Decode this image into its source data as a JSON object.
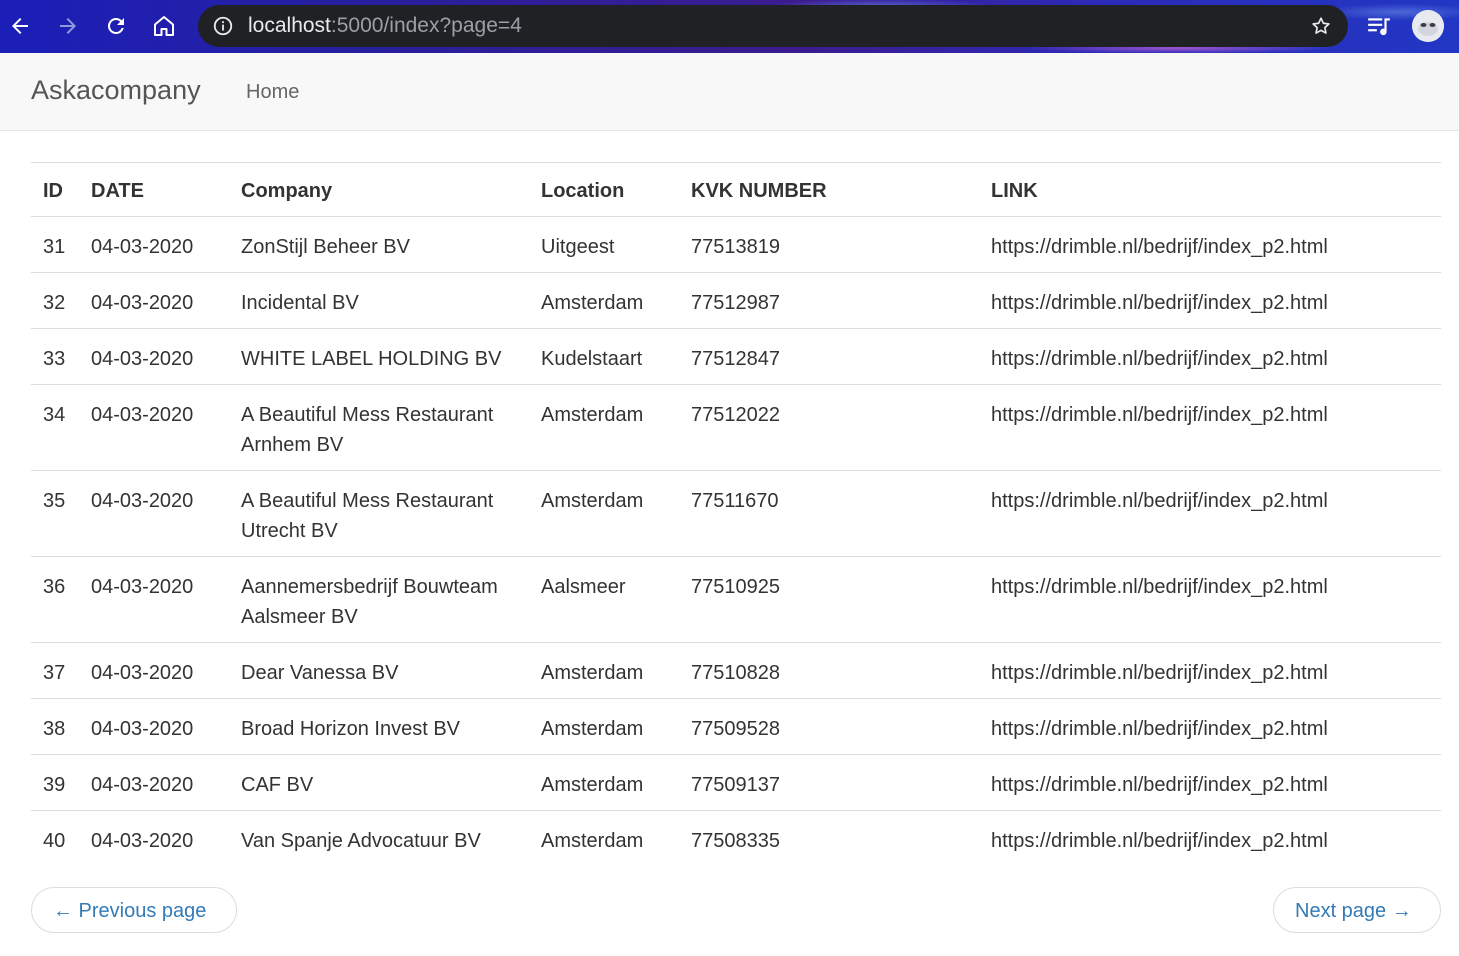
{
  "browser": {
    "url_host": "localhost",
    "url_rest": ":5000/index?page=4"
  },
  "navbar": {
    "brand": "Askacompany",
    "home": "Home"
  },
  "table": {
    "headers": {
      "id": "ID",
      "date": "DATE",
      "company": "Company",
      "location": "Location",
      "kvk": "KVK NUMBER",
      "link": "LINK"
    },
    "rows": [
      {
        "id": "31",
        "date": "04-03-2020",
        "company": "ZonStijl Beheer BV",
        "location": "Uitgeest",
        "kvk": "77513819",
        "link": "https://drimble.nl/bedrijf/index_p2.html"
      },
      {
        "id": "32",
        "date": "04-03-2020",
        "company": "Incidental BV",
        "location": "Amsterdam",
        "kvk": "77512987",
        "link": "https://drimble.nl/bedrijf/index_p2.html"
      },
      {
        "id": "33",
        "date": "04-03-2020",
        "company": "WHITE LABEL HOLDING BV",
        "location": "Kudelstaart",
        "kvk": "77512847",
        "link": "https://drimble.nl/bedrijf/index_p2.html"
      },
      {
        "id": "34",
        "date": "04-03-2020",
        "company": "A Beautiful Mess Restaurant Arnhem BV",
        "location": "Amsterdam",
        "kvk": "77512022",
        "link": "https://drimble.nl/bedrijf/index_p2.html"
      },
      {
        "id": "35",
        "date": "04-03-2020",
        "company": "A Beautiful Mess Restaurant Utrecht BV",
        "location": "Amsterdam",
        "kvk": "77511670",
        "link": "https://drimble.nl/bedrijf/index_p2.html"
      },
      {
        "id": "36",
        "date": "04-03-2020",
        "company": "Aannemersbedrijf Bouwteam Aalsmeer BV",
        "location": "Aalsmeer",
        "kvk": "77510925",
        "link": "https://drimble.nl/bedrijf/index_p2.html"
      },
      {
        "id": "37",
        "date": "04-03-2020",
        "company": "Dear Vanessa BV",
        "location": "Amsterdam",
        "kvk": "77510828",
        "link": "https://drimble.nl/bedrijf/index_p2.html"
      },
      {
        "id": "38",
        "date": "04-03-2020",
        "company": "Broad Horizon Invest BV",
        "location": "Amsterdam",
        "kvk": "77509528",
        "link": "https://drimble.nl/bedrijf/index_p2.html"
      },
      {
        "id": "39",
        "date": "04-03-2020",
        "company": "CAF BV",
        "location": "Amsterdam",
        "kvk": "77509137",
        "link": "https://drimble.nl/bedrijf/index_p2.html"
      },
      {
        "id": "40",
        "date": "04-03-2020",
        "company": "Van Spanje Advocatuur BV",
        "location": "Amsterdam",
        "kvk": "77508335",
        "link": "https://drimble.nl/bedrijf/index_p2.html"
      }
    ]
  },
  "pager": {
    "previous": "← Previous page",
    "next": "Next page →"
  },
  "colors": {
    "link_blue": "#337ab7",
    "navbar_bg": "#f8f8f8",
    "text": "#333333"
  }
}
